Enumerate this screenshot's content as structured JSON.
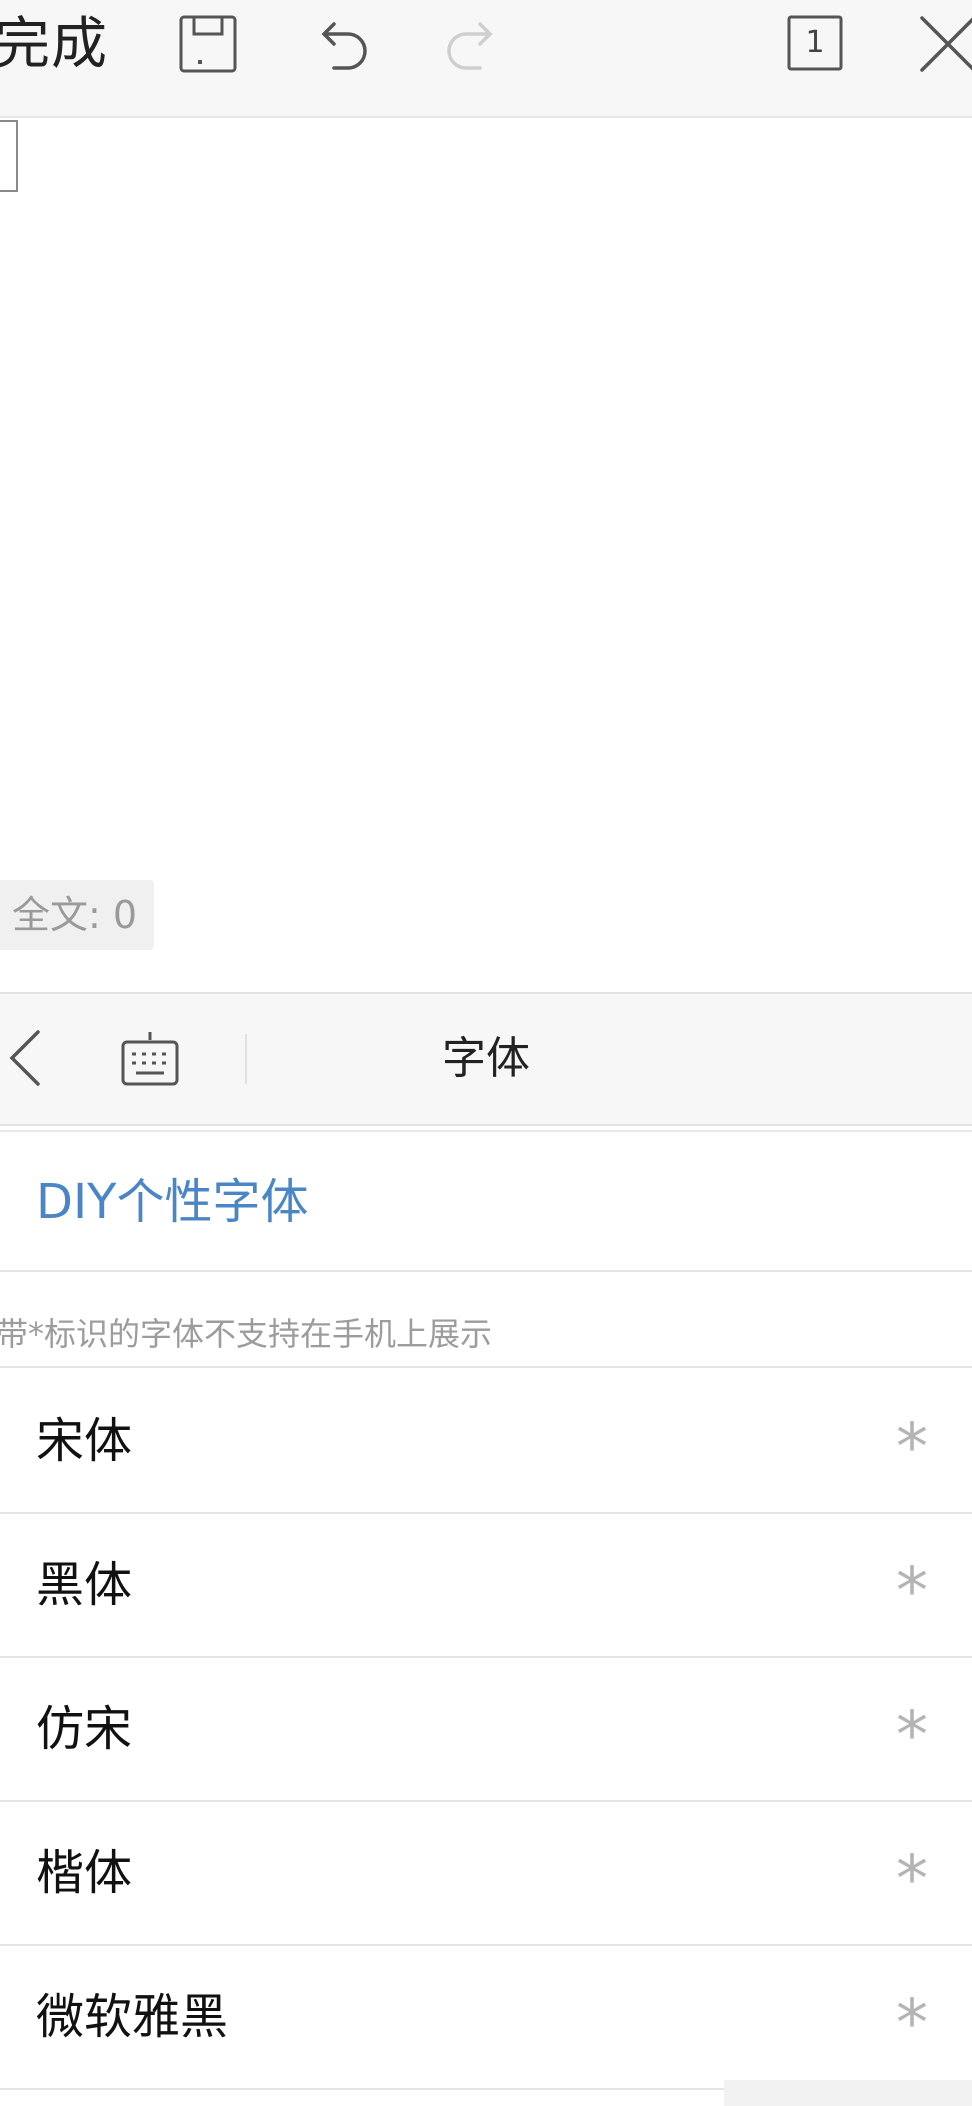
{
  "toolbar": {
    "done_label": "完成",
    "page_count": "1",
    "icons": [
      "save-icon",
      "undo-icon",
      "redo-icon",
      "page-count-icon",
      "close-icon"
    ]
  },
  "editor": {
    "word_count": "全文: 0"
  },
  "panel": {
    "title": "字体",
    "icons": [
      "back-chevron-icon",
      "keyboard-icon"
    ]
  },
  "fonts": {
    "diy_label": "DIY个性字体",
    "notice": "带*标识的字体不支持在手机上展示",
    "items": [
      {
        "name": "宋体",
        "marker": "*"
      },
      {
        "name": "黑体",
        "marker": "*"
      },
      {
        "name": "仿宋",
        "marker": "*"
      },
      {
        "name": "楷体",
        "marker": "*"
      },
      {
        "name": "微软雅黑",
        "marker": "*"
      }
    ]
  },
  "colors": {
    "accent": "#4a86c6",
    "toolbar_bg": "#f7f7f7",
    "muted_text": "#9c9c9c",
    "disabled_icon": "#c8c8c8"
  }
}
